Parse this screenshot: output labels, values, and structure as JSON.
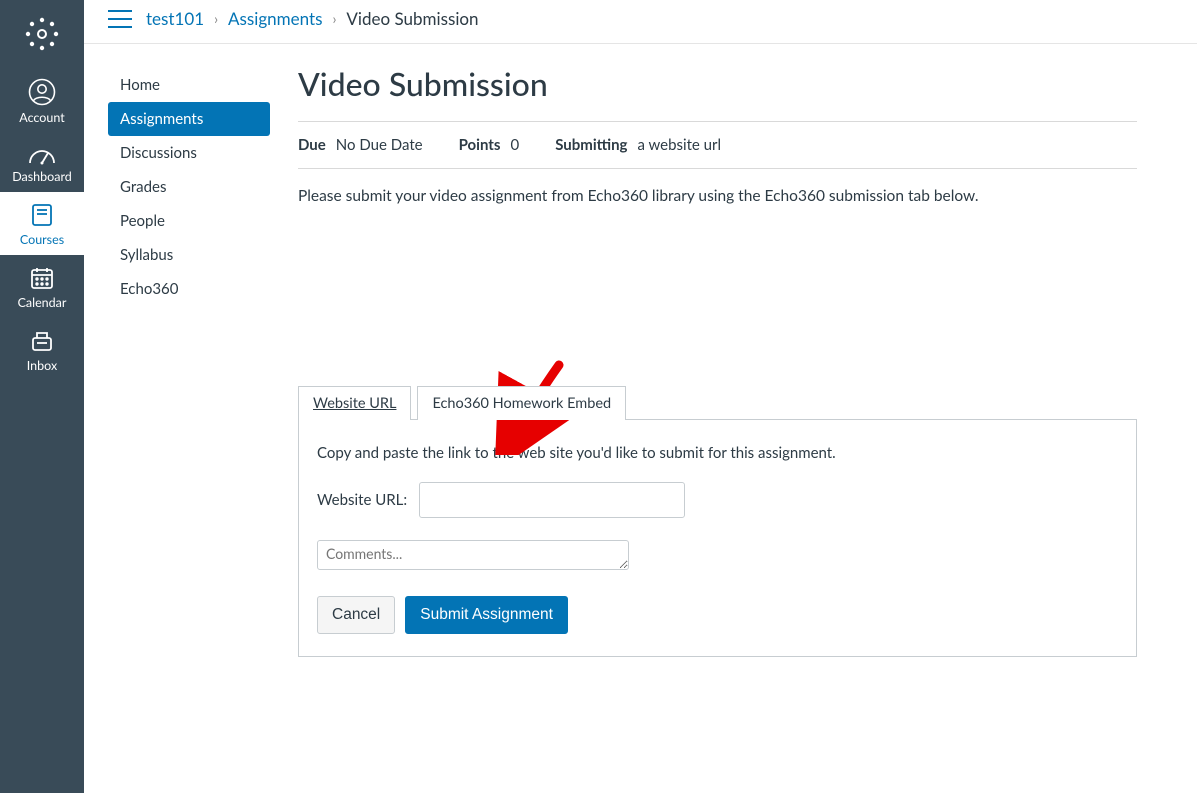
{
  "global_nav": {
    "items": [
      {
        "id": "logo",
        "label": ""
      },
      {
        "id": "account",
        "label": "Account"
      },
      {
        "id": "dashboard",
        "label": "Dashboard"
      },
      {
        "id": "courses",
        "label": "Courses"
      },
      {
        "id": "calendar",
        "label": "Calendar"
      },
      {
        "id": "inbox",
        "label": "Inbox"
      }
    ]
  },
  "breadcrumb": {
    "course": "test101",
    "section": "Assignments",
    "page": "Video Submission"
  },
  "course_nav": {
    "items": [
      {
        "label": "Home"
      },
      {
        "label": "Assignments",
        "active": true
      },
      {
        "label": "Discussions"
      },
      {
        "label": "Grades"
      },
      {
        "label": "People"
      },
      {
        "label": "Syllabus"
      },
      {
        "label": "Echo360"
      }
    ]
  },
  "assignment": {
    "title": "Video Submission",
    "due_label": "Due",
    "due_value": "No Due Date",
    "points_label": "Points",
    "points_value": "0",
    "submitting_label": "Submitting",
    "submitting_value": "a website url",
    "description": "Please submit your video assignment from Echo360 library using the Echo360 submission tab below."
  },
  "submission": {
    "tabs": [
      {
        "label": "Website URL",
        "active": true
      },
      {
        "label": "Echo360 Homework Embed"
      }
    ],
    "hint": "Copy and paste the link to the web site you'd like to submit for this assignment.",
    "url_label": "Website URL:",
    "url_value": "",
    "comments_placeholder": "Comments...",
    "cancel_label": "Cancel",
    "submit_label": "Submit Assignment"
  }
}
